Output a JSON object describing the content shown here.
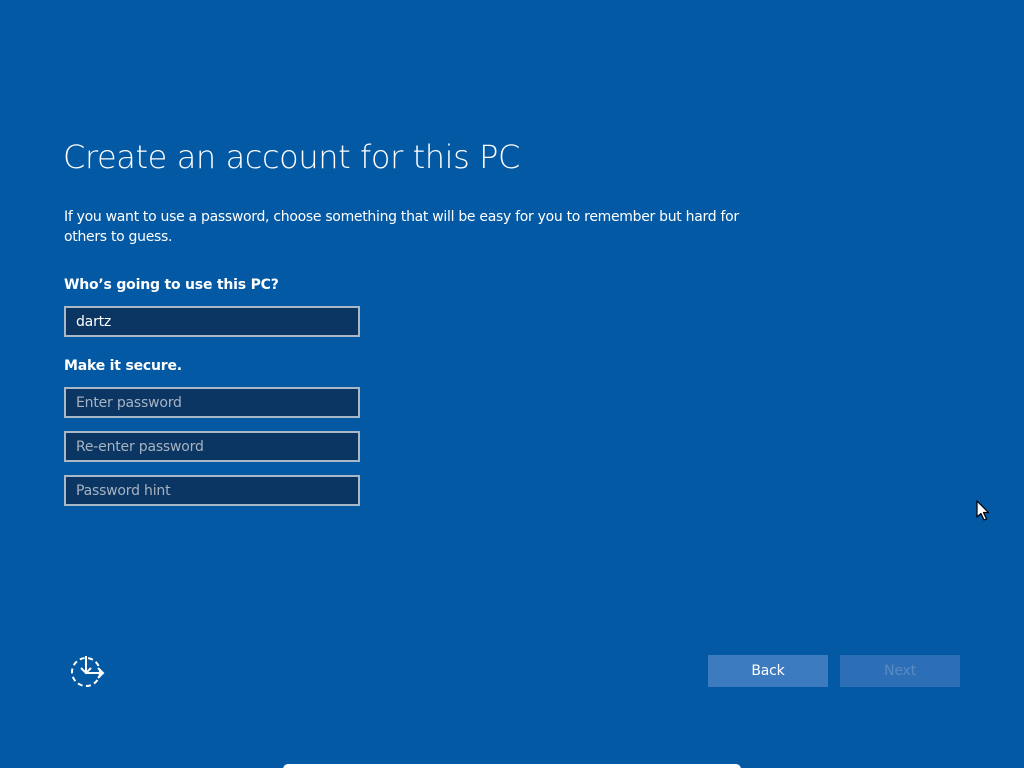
{
  "header": {
    "title": "Create an account for this PC",
    "description": "If you want to use a password, choose something that will be easy for you to remember but hard for others to guess."
  },
  "form": {
    "user_label": "Who’s going to use this PC?",
    "username_value": "dartz",
    "secure_label": "Make it secure.",
    "password_placeholder": "Enter password",
    "reenter_placeholder": "Re-enter password",
    "hint_placeholder": "Password hint"
  },
  "footer": {
    "accessibility_icon": "ease-of-access-icon",
    "back_label": "Back",
    "next_label": "Next"
  },
  "colors": {
    "background": "#0459a4",
    "field_bg": "#0b3563",
    "field_border": "#a9b8c7",
    "back_button": "#3d7bc0",
    "next_button_disabled": "#2d6fb6"
  }
}
